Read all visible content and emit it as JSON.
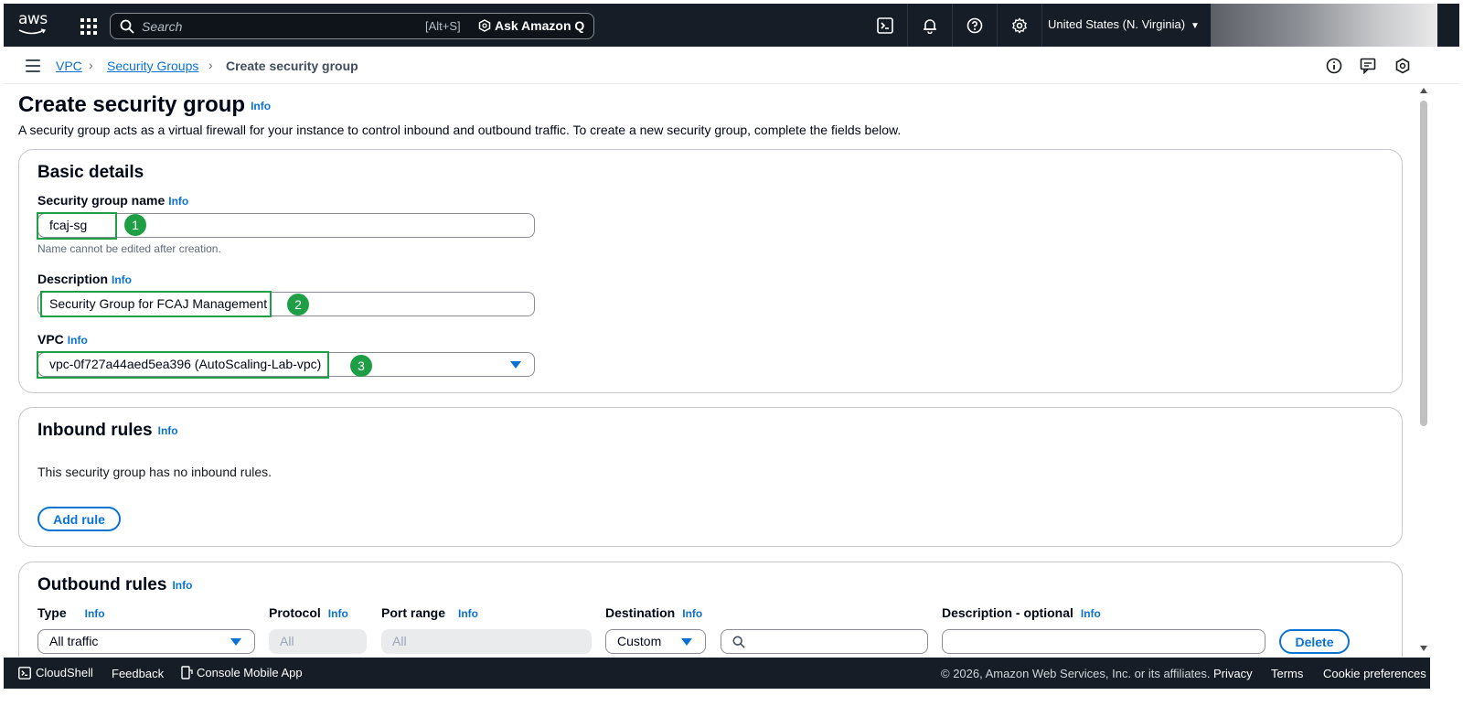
{
  "topnav": {
    "logo_text": "aws",
    "search_placeholder": "Search",
    "search_shortcut": "[Alt+S]",
    "ask_q_label": "Ask Amazon Q",
    "region_label": "United States (N. Virginia)",
    "icons": [
      "cloudshell-icon",
      "bell-icon",
      "help-icon",
      "settings-icon"
    ]
  },
  "breadcrumb": {
    "items": [
      "VPC",
      "Security Groups",
      "Create security group"
    ]
  },
  "page": {
    "title": "Create security group",
    "title_info": "Info",
    "description": "A security group acts as a virtual firewall for your instance to control inbound and outbound traffic. To create a new security group, complete the fields below."
  },
  "basic_details": {
    "heading": "Basic details",
    "name_label": "Security group name",
    "name_info": "Info",
    "name_value": "fcaj-sg",
    "name_hint": "Name cannot be edited after creation.",
    "desc_label": "Description",
    "desc_info": "Info",
    "desc_value": "Security Group for FCAJ Management",
    "vpc_label": "VPC",
    "vpc_info": "Info",
    "vpc_value": "vpc-0f727a44aed5ea396 (AutoScaling-Lab-vpc)",
    "annotations": [
      "1",
      "2",
      "3"
    ],
    "annotation_color": "#1e9e45"
  },
  "inbound": {
    "heading": "Inbound rules",
    "info": "Info",
    "empty_text": "This security group has no inbound rules.",
    "add_rule_label": "Add rule"
  },
  "outbound": {
    "heading": "Outbound rules",
    "info": "Info",
    "col_type": "Type",
    "col_protocol": "Protocol",
    "col_port": "Port range",
    "col_dest": "Destination",
    "col_desc": "Description - optional",
    "col_info": "Info",
    "type_value": "All traffic",
    "protocol_value": "All",
    "port_value": "All",
    "dest_value": "Custom",
    "delete_label": "Delete"
  },
  "footer": {
    "cloudshell": "CloudShell",
    "feedback": "Feedback",
    "mobile_app": "Console Mobile App",
    "copyright": "© 2026, Amazon Web Services, Inc. or its affiliates.",
    "privacy": "Privacy",
    "terms": "Terms",
    "cookies": "Cookie preferences"
  },
  "colors": {
    "nav_bg": "#161d26",
    "link": "#0972d3",
    "annotation": "#1e9e45"
  }
}
